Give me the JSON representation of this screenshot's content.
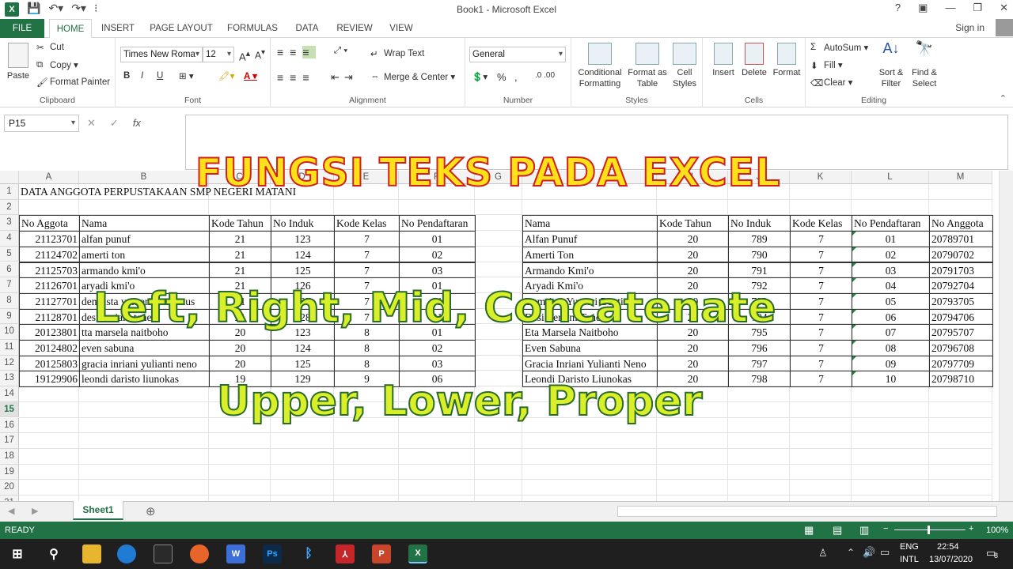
{
  "window": {
    "title": "Book1 - Microsoft Excel",
    "app_icon": "X"
  },
  "tabs": [
    "FILE",
    "HOME",
    "INSERT",
    "PAGE LAYOUT",
    "FORMULAS",
    "DATA",
    "REVIEW",
    "VIEW"
  ],
  "signin": "Sign in",
  "ribbon": {
    "clipboard": {
      "paste": "Paste",
      "cut": "Cut",
      "copy": "Copy",
      "format_painter": "Format Painter",
      "label": "Clipboard"
    },
    "font": {
      "name": "Times New Roma",
      "size": "12",
      "label": "Font",
      "bold": "B",
      "italic": "I",
      "underline": "U"
    },
    "alignment": {
      "wrap": "Wrap Text",
      "merge": "Merge & Center",
      "label": "Alignment"
    },
    "number": {
      "format": "General",
      "label": "Number",
      "percent": "%"
    },
    "styles": {
      "cond": "Conditional\nFormatting",
      "table": "Format as\nTable",
      "cell": "Cell\nStyles",
      "label": "Styles"
    },
    "cells": {
      "insert": "Insert",
      "delete": "Delete",
      "format": "Format",
      "label": "Cells"
    },
    "editing": {
      "autosum": "AutoSum",
      "fill": "Fill",
      "clear": "Clear",
      "sort": "Sort &\nFilter",
      "find": "Find &\nSelect",
      "label": "Editing"
    }
  },
  "formula_bar": {
    "name_box": "P15",
    "fx": "fx",
    "value": ""
  },
  "columns": [
    "A",
    "B",
    "C",
    "D",
    "E",
    "F",
    "G",
    "H",
    "I",
    "J",
    "K",
    "L",
    "M"
  ],
  "rows": [
    "1",
    "2",
    "3",
    "4",
    "5",
    "6",
    "7",
    "8",
    "9",
    "10",
    "11",
    "12",
    "13",
    "14",
    "15",
    "16",
    "17",
    "18",
    "19",
    "20",
    "21"
  ],
  "selected_row": "15",
  "sheet": {
    "title": "DATA ANGGOTA PERPUSTAKAAN SMP NEGERI MATANI",
    "left_headers": [
      "No Aggota",
      "Nama",
      "Kode Tahun",
      "No Induk",
      "Kode Kelas",
      "No Pendaftaran"
    ],
    "left_rows": [
      [
        "21123701",
        "alfan punuf",
        "21",
        "123",
        "7",
        "01"
      ],
      [
        "21124702",
        "amerti ton",
        "21",
        "124",
        "7",
        "02"
      ],
      [
        "21125703",
        "armando kmi'o",
        "21",
        "125",
        "7",
        "03"
      ],
      [
        "21126701",
        "aryadi kmi'o",
        "21",
        "126",
        "7",
        "01"
      ],
      [
        "21127701",
        "demrista yumeri bentianus",
        "21",
        "127",
        "7",
        "01"
      ],
      [
        "21128701",
        "desi veriani tanec",
        "21",
        "128",
        "7",
        "01"
      ],
      [
        "20123801",
        "tta marsela naitboho",
        "20",
        "123",
        "8",
        "01"
      ],
      [
        "20124802",
        "even sabuna",
        "20",
        "124",
        "8",
        "02"
      ],
      [
        "20125803",
        "gracia inriani yulianti neno",
        "20",
        "125",
        "8",
        "03"
      ],
      [
        "19129906",
        "leondi daristo liunokas",
        "19",
        "129",
        "9",
        "06"
      ]
    ],
    "right_headers": [
      "Nama",
      "Kode Tahun",
      "No Induk",
      "Kode Kelas",
      "No Pendaftaran",
      "No Anggota"
    ],
    "right_rows": [
      [
        "Alfan Punuf",
        "20",
        "789",
        "7",
        "01",
        "20789701"
      ],
      [
        "Amerti Ton",
        "20",
        "790",
        "7",
        "02",
        "20790702"
      ],
      [
        "Armando Kmi'o",
        "20",
        "791",
        "7",
        "03",
        "20791703"
      ],
      [
        "Aryadi Kmi'o",
        "20",
        "792",
        "7",
        "04",
        "20792704"
      ],
      [
        "Demrista Yumeri Bentianus",
        "20",
        "793",
        "7",
        "05",
        "20793705"
      ],
      [
        "Desi Veriani Tanec",
        "20",
        "794",
        "7",
        "06",
        "20794706"
      ],
      [
        "Eta Marsela Naitboho",
        "20",
        "795",
        "7",
        "07",
        "20795707"
      ],
      [
        "Even Sabuna",
        "20",
        "796",
        "7",
        "08",
        "20796708"
      ],
      [
        "Gracia Inriani Yulianti Neno",
        "20",
        "797",
        "7",
        "09",
        "20797709"
      ],
      [
        "Leondi Daristo Liunokas",
        "20",
        "798",
        "7",
        "10",
        "20798710"
      ]
    ]
  },
  "overlay": {
    "title": "FUNGSI TEKS PADA EXCEL",
    "line1": "Left, Right, Mid, Concatenate",
    "line2": "Upper, Lower, Proper"
  },
  "sheet_tab": "Sheet1",
  "status": {
    "ready": "READY",
    "zoom": "100%"
  },
  "taskbar": {
    "lang1": "ENG",
    "lang2": "INTL",
    "time": "22:54",
    "date": "13/07/2020",
    "notif": "8"
  },
  "colors": {
    "excel_green": "#217346",
    "overlay_title": "#ffe11a",
    "overlay_stroke": "#d01f1f",
    "overlay_lines": "#d9ef2a"
  }
}
